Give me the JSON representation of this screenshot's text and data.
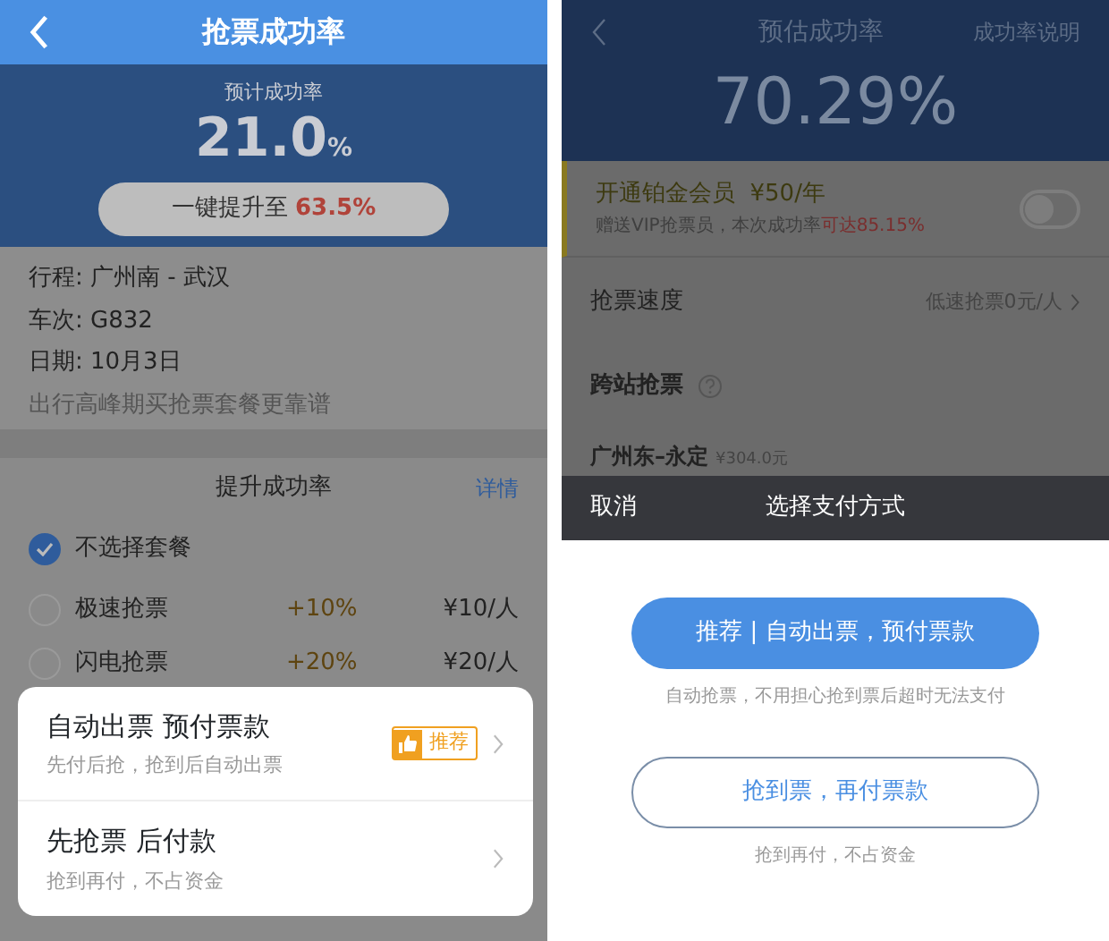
{
  "left_screen": {
    "nav": {
      "title": "抢票成功率"
    },
    "estimate": {
      "label": "预计成功率",
      "value": "21.0",
      "unit": "%"
    },
    "boost_button": {
      "label": "一键提升至",
      "value": "63.5%"
    },
    "trip_info": [
      "行程: 广州南 - 武汉",
      "车次: G832",
      "日期: 10月3日"
    ],
    "tip": "出行高峰期买抢票套餐更靠谱",
    "packages": {
      "title": "提升成功率",
      "link": "详情",
      "options": [
        {
          "name": "不选择套餐",
          "selected": true
        },
        {
          "name": "极速抢票",
          "bonus": "+10%",
          "price": "¥10/人",
          "selected": false
        },
        {
          "name": "闪电抢票",
          "bonus": "+20%",
          "price": "¥20/人",
          "selected": false
        }
      ]
    },
    "payment_sheet": {
      "options": [
        {
          "title": "自动出票 预付票款",
          "subtitle": "先付后抢，抢到后自动出票",
          "badge": "推荐"
        },
        {
          "title": "先抢票 后付款",
          "subtitle": "抢到再付，不占资金"
        }
      ]
    }
  },
  "right_screen": {
    "nav": {
      "title": "预估成功率",
      "link": "成功率说明"
    },
    "rate": "70.29%",
    "vip": {
      "title": "开通铂金会员",
      "price": "¥50/年",
      "desc": "赠送VIP抢票员，本次成功率",
      "desc_highlight": "可达85.15%",
      "on": false
    },
    "speed": {
      "label": "抢票速度",
      "value": "低速抢票0元/人"
    },
    "cross_station": {
      "label": "跨站抢票"
    },
    "route": {
      "name": "广州东–永定",
      "price": "¥304.0元"
    },
    "sheet": {
      "cancel": "取消",
      "title": "选择支付方式",
      "options": [
        {
          "kind": "primary",
          "label": "推荐 | 自动出票，预付票款",
          "note": "自动抢票，不用担心抢到票后超时无法支付"
        },
        {
          "kind": "outline",
          "label": "抢到票，再付票款",
          "note": "抢到再付，不占资金"
        }
      ]
    }
  }
}
